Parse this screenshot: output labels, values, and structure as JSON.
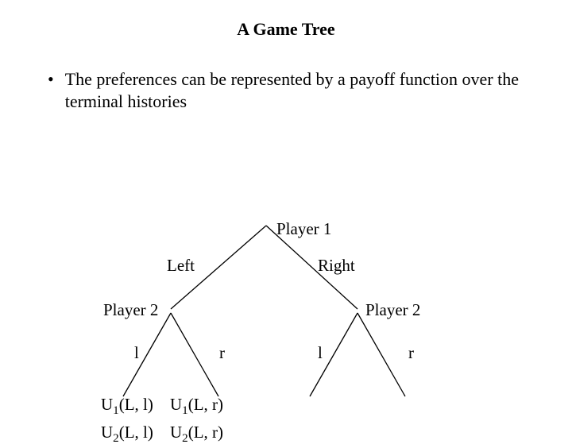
{
  "title": "A Game Tree",
  "bullet": "The preferences can be represented by a payoff function over the terminal histories",
  "labels": {
    "root": "Player 1",
    "leftBranch": "Left",
    "rightBranch": "Right",
    "leftPlayer": "Player 2",
    "rightPlayer": "Player 2",
    "ll": "l",
    "lr": "r",
    "rl": "l",
    "rr": "r"
  },
  "payoffs": {
    "u1Ll": "U",
    "u1Ll_sub": "1",
    "u1Ll_args": "(L, l)",
    "u1Lr": "U",
    "u1Lr_sub": "1",
    "u1Lr_args": "(L, r)",
    "u2Ll": "U",
    "u2Ll_sub": "2",
    "u2Ll_args": "(L, l)",
    "u2Lr": "U",
    "u2Lr_sub": "2",
    "u2Lr_args": "(L, r)"
  }
}
